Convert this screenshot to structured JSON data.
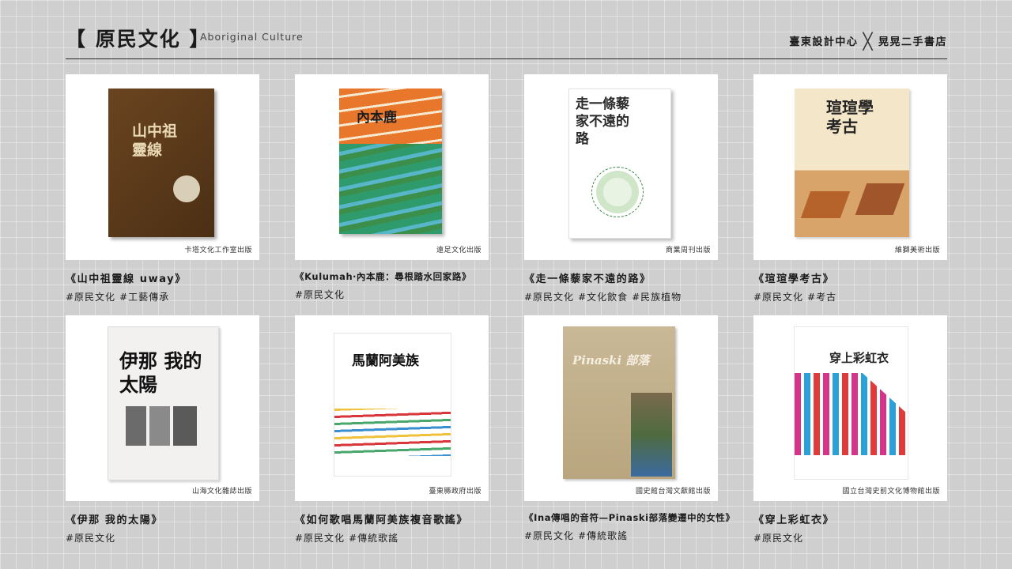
{
  "header": {
    "title": "【 原民文化 】",
    "subtitle": "Aboriginal Culture",
    "brand_left": "臺東設計中心",
    "brand_right": "晃晃二手書店"
  },
  "books": [
    {
      "title": "《山中祖靈線 uway》",
      "tags": [
        "#原民文化",
        "#工藝傳承"
      ],
      "publisher": "卡塔文化工作室出版",
      "cover_title": "山中祖靈線",
      "cover_colors": [
        "#4b2f14",
        "#6a4420"
      ]
    },
    {
      "title": "《Kulumah‧內本鹿：尋根踏水回家路》",
      "tags": [
        "#原民文化"
      ],
      "publisher": "遠足文化出版",
      "cover_title": "內本鹿",
      "cover_colors": [
        "#e8772b",
        "#2f9b6c",
        "#57b6c7"
      ]
    },
    {
      "title": "《走一條藜家不遠的路》",
      "tags": [
        "#原民文化",
        "#文化飲食",
        "#民族植物"
      ],
      "publisher": "商業周刊出版",
      "cover_title": "走一條藜家不遠的路",
      "cover_colors": [
        "#ffffff",
        "#3c8a45"
      ]
    },
    {
      "title": "《瑄瑄學考古》",
      "tags": [
        "#原民文化",
        "#考古"
      ],
      "publisher": "維獅美術出版",
      "cover_title": "瑄瑄學考古",
      "cover_colors": [
        "#f4e6c9",
        "#b5632b"
      ]
    },
    {
      "title": "《伊那 我的太陽》",
      "tags": [
        "#原民文化"
      ],
      "publisher": "山海文化雜誌出版",
      "cover_title": "伊那 我的太陽",
      "cover_colors": [
        "#f2f1ef",
        "#111111"
      ]
    },
    {
      "title": "《如何歌唱馬蘭阿美族複音歌謠》",
      "tags": [
        "#原民文化",
        "#傳統歌謠"
      ],
      "publisher": "臺東縣政府出版",
      "cover_title": "馬蘭阿美族",
      "cover_colors": [
        "#ffffff",
        "#d8363b"
      ]
    },
    {
      "title": "《Ina傳唱的音符—Pinaski部落變遷中的女性》",
      "tags": [
        "#原民文化",
        "#傳統歌謠"
      ],
      "publisher": "國史館台灣文獻館出版",
      "cover_title": "Pinaski 部落",
      "cover_colors": [
        "#c9b896",
        "#7a6a4d"
      ]
    },
    {
      "title": "《穿上彩虹衣》",
      "tags": [
        "#原民文化"
      ],
      "publisher": "國立台灣史前文化博物館出版",
      "cover_title": "穿上彩虹衣",
      "cover_colors": [
        "#ffffff",
        "#d6338a",
        "#2aa1d8"
      ]
    }
  ]
}
